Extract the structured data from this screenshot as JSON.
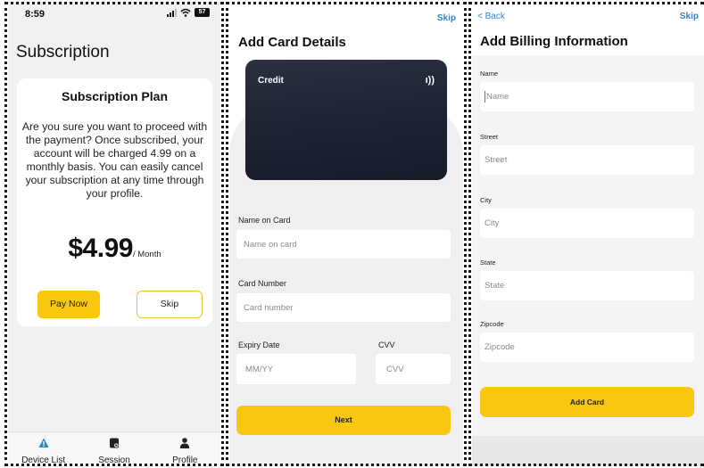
{
  "screen1": {
    "status_time": "8:59",
    "battery": "57",
    "title": "Subscription",
    "plan_heading": "Subscription Plan",
    "plan_body": "Are you sure you want to proceed with the payment? Once subscribed, your account will be charged 4.99 on a monthly basis. You can easily cancel your subscription at any time through your profile.",
    "price": "$4.99",
    "price_unit": "/ Month",
    "pay_now_label": "Pay Now",
    "skip_label": "Skip",
    "tabs": [
      {
        "label": "Device List",
        "icon": "warning-triangle-icon",
        "color": "#2c86d3"
      },
      {
        "label": "Session",
        "icon": "session-icon",
        "color": "#222222"
      },
      {
        "label": "Profile",
        "icon": "person-icon",
        "color": "#222222"
      }
    ]
  },
  "screen2": {
    "skip_label": "Skip",
    "title": "Add Card Details",
    "card_label": "Credit",
    "card_contactless_icon": "contactless-icon",
    "name_label": "Name on Card",
    "name_placeholder": "Name on card",
    "number_label": "Card Number",
    "number_placeholder": "Card number",
    "expiry_label": "Expiry Date",
    "expiry_placeholder": "MM/YY",
    "cvv_label": "CVV",
    "cvv_placeholder": "CVV",
    "next_label": "Next"
  },
  "screen3": {
    "back_label": "< Back",
    "skip_label": "Skip",
    "title": "Add Billing Information",
    "fields": [
      {
        "label": "Name",
        "placeholder": "Name"
      },
      {
        "label": "Street",
        "placeholder": "Street"
      },
      {
        "label": "City",
        "placeholder": "City"
      },
      {
        "label": "State",
        "placeholder": "State"
      },
      {
        "label": "Zipcode",
        "placeholder": "Zipcode"
      }
    ],
    "add_card_label": "Add Card"
  },
  "colors": {
    "accent_yellow": "#f9c712",
    "link_blue": "#2c86d3",
    "card_dark": "#1e2433"
  }
}
